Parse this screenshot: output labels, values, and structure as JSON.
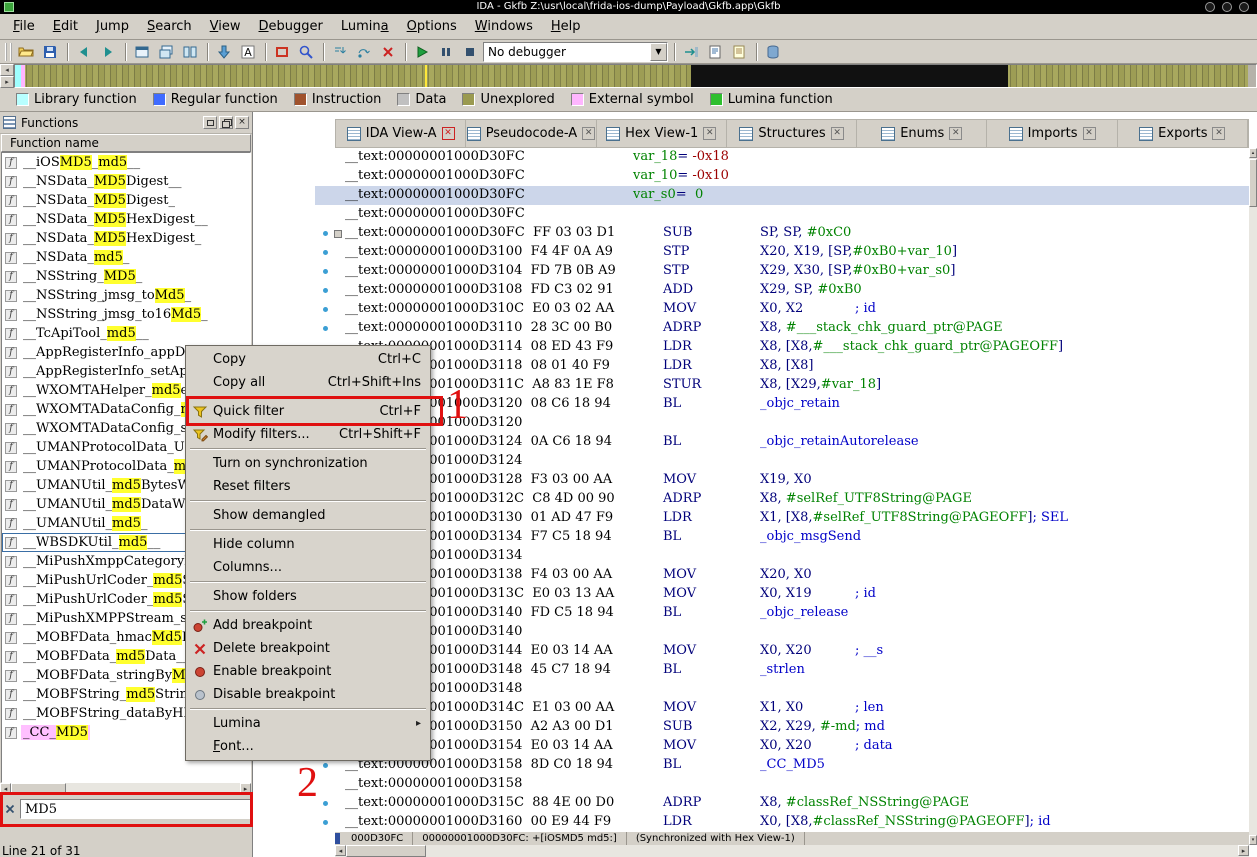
{
  "window": {
    "title": "IDA - Gkfb Z:\\usr\\local\\frida-ios-dump\\Payload\\Gkfb.app\\Gkfb"
  },
  "menubar": {
    "items": [
      {
        "label": "File",
        "u": 0
      },
      {
        "label": "Edit",
        "u": 0
      },
      {
        "label": "Jump",
        "u": 0
      },
      {
        "label": "Search",
        "u": 0
      },
      {
        "label": "View",
        "u": 0
      },
      {
        "label": "Debugger",
        "u": 0
      },
      {
        "label": "Lumina",
        "u": 5
      },
      {
        "label": "Options",
        "u": 0
      },
      {
        "label": "Windows",
        "u": 0
      },
      {
        "label": "Help",
        "u": 0
      }
    ]
  },
  "toolbar": {
    "debugger_select": "No debugger",
    "buttons": [
      {
        "name": "open-file-icon"
      },
      {
        "name": "save-icon"
      },
      {
        "sep": true
      },
      {
        "name": "nav-back-icon"
      },
      {
        "name": "nav-forward-icon"
      },
      {
        "sep": true
      },
      {
        "name": "window-list-icon"
      },
      {
        "name": "window-stack-icon"
      },
      {
        "name": "window-tile-icon"
      },
      {
        "sep": true
      },
      {
        "name": "jump-address-icon"
      },
      {
        "name": "names-icon"
      },
      {
        "sep": true
      },
      {
        "name": "breakpoint-list-icon"
      },
      {
        "name": "search-icon"
      },
      {
        "sep": true
      },
      {
        "name": "step-into-icon"
      },
      {
        "name": "step-over-icon"
      },
      {
        "name": "cancel-icon"
      },
      {
        "sep": true
      },
      {
        "name": "start-process-icon"
      },
      {
        "name": "pause-process-icon"
      },
      {
        "name": "stop-process-icon"
      },
      {
        "combo": true
      },
      {
        "sep": true
      },
      {
        "name": "attach-icon"
      },
      {
        "name": "script-icon"
      },
      {
        "name": "notepad-icon"
      },
      {
        "sep": true
      },
      {
        "name": "database-icon"
      }
    ]
  },
  "legend": {
    "items": [
      {
        "label": "Library function",
        "color": "#b8ffff"
      },
      {
        "label": "Regular function",
        "color": "#3f6bff"
      },
      {
        "label": "Instruction",
        "color": "#a0522d"
      },
      {
        "label": "Data",
        "color": "#c0c0c0"
      },
      {
        "label": "Unexplored",
        "color": "#9a9a50"
      },
      {
        "label": "External symbol",
        "color": "#ffb6ff"
      },
      {
        "label": "Lumina function",
        "color": "#2fbf2f"
      }
    ]
  },
  "tabs": {
    "items": [
      {
        "label": "IDA View-A",
        "icon": "ida-view-icon",
        "active": true
      },
      {
        "label": "Pseudocode-A",
        "icon": "pseudocode-icon",
        "active": false
      },
      {
        "label": "Hex View-1",
        "icon": "hex-view-icon",
        "active": false
      },
      {
        "label": "Structures",
        "icon": "structures-icon",
        "active": false
      },
      {
        "label": "Enums",
        "icon": "enums-icon",
        "active": false
      },
      {
        "label": "Imports",
        "icon": "imports-icon",
        "active": false
      },
      {
        "label": "Exports",
        "icon": "exports-icon",
        "active": false
      }
    ]
  },
  "functions": {
    "title": "Functions",
    "column_header": "Function name",
    "filter_value": "MD5",
    "status_line": "Line 21 of 31",
    "rows": [
      {
        "segs": [
          [
            "__iOS",
            0
          ],
          [
            "MD5",
            1
          ],
          [
            "_",
            0
          ],
          [
            "md5",
            1
          ],
          [
            "__",
            0
          ]
        ]
      },
      {
        "segs": [
          [
            "__NSData_",
            0
          ],
          [
            "MD5",
            1
          ],
          [
            "Digest__",
            0
          ]
        ]
      },
      {
        "segs": [
          [
            "__NSData_",
            0
          ],
          [
            "MD5",
            1
          ],
          [
            "Digest_",
            0
          ]
        ]
      },
      {
        "segs": [
          [
            "__NSData_",
            0
          ],
          [
            "MD5",
            1
          ],
          [
            "HexDigest__",
            0
          ]
        ]
      },
      {
        "segs": [
          [
            "__NSData_",
            0
          ],
          [
            "MD5",
            1
          ],
          [
            "HexDigest_",
            0
          ]
        ]
      },
      {
        "segs": [
          [
            "__NSData_",
            0
          ],
          [
            "md5",
            1
          ],
          [
            "_",
            0
          ]
        ]
      },
      {
        "segs": [
          [
            "__NSString_",
            0
          ],
          [
            "MD5",
            1
          ],
          [
            "_",
            0
          ]
        ]
      },
      {
        "segs": [
          [
            "__NSString_jmsg_to",
            0
          ],
          [
            "Md5",
            1
          ],
          [
            "_",
            0
          ]
        ]
      },
      {
        "segs": [
          [
            "__NSString_jmsg_to16",
            0
          ],
          [
            "Md5",
            1
          ],
          [
            "_",
            0
          ]
        ]
      },
      {
        "segs": [
          [
            "__TcApiTool_",
            0
          ],
          [
            "md5",
            1
          ],
          [
            "__",
            0
          ]
        ]
      },
      {
        "segs": [
          [
            "__AppRegisterInfo_appDow...",
            0
          ]
        ]
      },
      {
        "segs": [
          [
            "__AppRegisterInfo_setAppD...",
            0
          ]
        ]
      },
      {
        "segs": [
          [
            "__WXOMTAHelper_",
            0
          ],
          [
            "md5",
            1
          ],
          [
            "enc...",
            0
          ]
        ]
      },
      {
        "segs": [
          [
            "__WXOMTADataConfig_",
            0
          ],
          [
            "md",
            1
          ],
          [
            "...",
            0
          ]
        ]
      },
      {
        "segs": [
          [
            "__WXOMTADataConfig_set...",
            0
          ]
        ]
      },
      {
        "segs": [
          [
            "__UMANProtocolData_UUID...",
            0
          ]
        ]
      },
      {
        "segs": [
          [
            "__UMANProtocolData_",
            0
          ],
          [
            "md5",
            1
          ],
          [
            "...",
            0
          ]
        ]
      },
      {
        "segs": [
          [
            "__UMANUtil_",
            0
          ],
          [
            "md5",
            1
          ],
          [
            "BytesWith...",
            0
          ]
        ]
      },
      {
        "segs": [
          [
            "__UMANUtil_",
            0
          ],
          [
            "md5",
            1
          ],
          [
            "DataWithI...",
            0
          ]
        ]
      },
      {
        "segs": [
          [
            "__UMANUtil_",
            0
          ],
          [
            "md5",
            1
          ],
          [
            "_",
            0
          ]
        ]
      },
      {
        "segs": [
          [
            "__WBSDKUtil_",
            0
          ],
          [
            "md5",
            1
          ],
          [
            "__",
            0
          ]
        ],
        "focused": true
      },
      {
        "segs": [
          [
            "__MiPushXmppCategoryNS...",
            0
          ]
        ]
      },
      {
        "segs": [
          [
            "__MiPushUrlCoder_",
            0
          ],
          [
            "md5",
            1
          ],
          [
            "Stri...",
            0
          ]
        ]
      },
      {
        "segs": [
          [
            "__MiPushUrlCoder_",
            0
          ],
          [
            "md5",
            1
          ],
          [
            "Stri...",
            0
          ]
        ]
      },
      {
        "segs": [
          [
            "__MiPushXMPPStream_sup...",
            0
          ]
        ]
      },
      {
        "segs": [
          [
            "__MOBFData_hmac",
            0
          ],
          [
            "Md5",
            1
          ],
          [
            "Dat...",
            0
          ]
        ]
      },
      {
        "segs": [
          [
            "__MOBFData_",
            0
          ],
          [
            "md5",
            1
          ],
          [
            "Data__",
            0
          ]
        ]
      },
      {
        "segs": [
          [
            "__MOBFData_stringBy",
            0
          ],
          [
            "MD5",
            1
          ],
          [
            "...",
            0
          ]
        ]
      },
      {
        "segs": [
          [
            "__MOBFString_",
            0
          ],
          [
            "md5",
            1
          ],
          [
            "String_...",
            0
          ]
        ]
      },
      {
        "segs": [
          [
            "__MOBFString_dataByHMA...",
            0
          ]
        ]
      },
      {
        "segs": [
          [
            "_CC_",
            0
          ],
          [
            "MD5",
            1
          ]
        ],
        "external": true
      }
    ]
  },
  "disasm": {
    "lines": [
      {
        "a": "__text:00000001000D30FC",
        "vd": "var_18= -0x18"
      },
      {
        "a": "__text:00000001000D30FC",
        "vd": "var_10= -0x10"
      },
      {
        "a": "__text:00000001000D30FC",
        "vd": "var_s0=  0",
        "sel": true
      },
      {
        "a": "__text:00000001000D30FC"
      },
      {
        "a": "__text:00000001000D30FC",
        "b": "FF 03 03 D1",
        "m": "SUB",
        "o": "SP, SP, #0xC0",
        "collapse": true
      },
      {
        "a": "__text:00000001000D3100",
        "b": "F4 4F 0A A9",
        "m": "STP",
        "o": "X20, X19, [SP,#0xB0+var_10]"
      },
      {
        "a": "__text:00000001000D3104",
        "b": "FD 7B 0B A9",
        "m": "STP",
        "o": "X29, X30, [SP,#0xB0+var_s0]"
      },
      {
        "a": "__text:00000001000D3108",
        "b": "FD C3 02 91",
        "m": "ADD",
        "o": "X29, SP, #0xB0"
      },
      {
        "a": "__text:00000001000D310C",
        "b": "E0 03 02 AA",
        "m": "MOV",
        "o": "X0, X2",
        "c": "; id"
      },
      {
        "a": "__text:00000001000D3110",
        "b": "28 3C 00 B0",
        "m": "ADRP",
        "o": "X8, #___stack_chk_guard_ptr@PAGE"
      },
      {
        "a": "__text:00000001000D3114",
        "b": "08 ED 43 F9",
        "m": "LDR",
        "o": "X8, [X8,#___stack_chk_guard_ptr@PAGEOFF]"
      },
      {
        "a": "__text:00000001000D3118",
        "b": "08 01 40 F9",
        "m": "LDR",
        "o": "X8, [X8]"
      },
      {
        "a": "__text:00000001000D311C",
        "b": "A8 83 1E F8",
        "m": "STUR",
        "o": "X8, [X29,#var_18]"
      },
      {
        "a": "__text:00000001000D3120",
        "b": "08 C6 18 94",
        "m": "BL",
        "o": "_objc_retain"
      },
      {
        "a": "__text:00000001000D3120"
      },
      {
        "a": "__text:00000001000D3124",
        "b": "0A C6 18 94",
        "m": "BL",
        "o": "_objc_retainAutorelease"
      },
      {
        "a": "__text:00000001000D3124"
      },
      {
        "a": "__text:00000001000D3128",
        "b": "F3 03 00 AA",
        "m": "MOV",
        "o": "X19, X0"
      },
      {
        "a": "__text:00000001000D312C",
        "b": "C8 4D 00 90",
        "m": "ADRP",
        "o": "X8, #selRef_UTF8String@PAGE"
      },
      {
        "a": "__text:00000001000D3130",
        "b": "01 AD 47 F9",
        "m": "LDR",
        "o": "X1, [X8,#selRef_UTF8String@PAGEOFF]",
        "c": "; SEL"
      },
      {
        "a": "__text:00000001000D3134",
        "b": "F7 C5 18 94",
        "m": "BL",
        "o": "_objc_msgSend"
      },
      {
        "a": "__text:00000001000D3134"
      },
      {
        "a": "__text:00000001000D3138",
        "b": "F4 03 00 AA",
        "m": "MOV",
        "o": "X20, X0"
      },
      {
        "a": "__text:00000001000D313C",
        "b": "E0 03 13 AA",
        "m": "MOV",
        "o": "X0, X19",
        "c": "; id"
      },
      {
        "a": "__text:00000001000D3140",
        "b": "FD C5 18 94",
        "m": "BL",
        "o": "_objc_release"
      },
      {
        "a": "__text:00000001000D3140"
      },
      {
        "a": "__text:00000001000D3144",
        "b": "E0 03 14 AA",
        "m": "MOV",
        "o": "X0, X20",
        "c": "; __s"
      },
      {
        "a": "__text:00000001000D3148",
        "b": "45 C7 18 94",
        "m": "BL",
        "o": "_strlen"
      },
      {
        "a": "__text:00000001000D3148"
      },
      {
        "a": "__text:00000001000D314C",
        "b": "E1 03 00 AA",
        "m": "MOV",
        "o": "X1, X0",
        "c": "; len"
      },
      {
        "a": "__text:00000001000D3150",
        "b": "A2 A3 00 D1",
        "m": "SUB",
        "o": "X2, X29, #-md",
        "c": "; md"
      },
      {
        "a": "__text:00000001000D3154",
        "b": "E0 03 14 AA",
        "m": "MOV",
        "o": "X0, X20",
        "c": "; data"
      },
      {
        "a": "__text:00000001000D3158",
        "b": "8D C0 18 94",
        "m": "BL",
        "o": "_CC_MD5"
      },
      {
        "a": "__text:00000001000D3158"
      },
      {
        "a": "__text:00000001000D315C",
        "b": "88 4E 00 D0",
        "m": "ADRP",
        "o": "X8, #classRef_NSString@PAGE"
      },
      {
        "a": "__text:00000001000D3160",
        "b": "00 E9 44 F9",
        "m": "LDR",
        "o": "X0, [X8,#classRef_NSString@PAGEOFF]",
        "c": "; id"
      }
    ],
    "status_cells": [
      "000D30FC",
      "00000001000D30FC: +[iOSMD5 md5:]",
      "(Synchronized with Hex View-1)"
    ]
  },
  "context_menu": {
    "items": [
      {
        "label": "Copy",
        "shortcut": "Ctrl+C"
      },
      {
        "label": "Copy all",
        "shortcut": "Ctrl+Shift+Ins"
      },
      {
        "sep": true
      },
      {
        "label": "Quick filter",
        "shortcut": "Ctrl+F",
        "icon": "filter-icon"
      },
      {
        "label": "Modify filters...",
        "shortcut": "Ctrl+Shift+F",
        "icon": "filter-edit-icon"
      },
      {
        "sep": true
      },
      {
        "label": "Turn on synchronization"
      },
      {
        "label": "Reset filters"
      },
      {
        "sep": true
      },
      {
        "label": "Show demangled"
      },
      {
        "sep": true
      },
      {
        "label": "Hide column"
      },
      {
        "label": "Columns..."
      },
      {
        "sep": true
      },
      {
        "label": "Show folders"
      },
      {
        "sep": true
      },
      {
        "label": "Add breakpoint",
        "icon": "breakpoint-add-icon"
      },
      {
        "label": "Delete breakpoint",
        "icon": "breakpoint-delete-icon"
      },
      {
        "label": "Enable breakpoint",
        "icon": "breakpoint-enable-icon"
      },
      {
        "label": "Disable breakpoint",
        "icon": "breakpoint-disable-icon"
      },
      {
        "sep": true
      },
      {
        "label": "Lumina",
        "submenu": true
      },
      {
        "label": "Font...",
        "u": 0
      }
    ]
  },
  "annotations": {
    "step1": "1",
    "step2": "2"
  }
}
